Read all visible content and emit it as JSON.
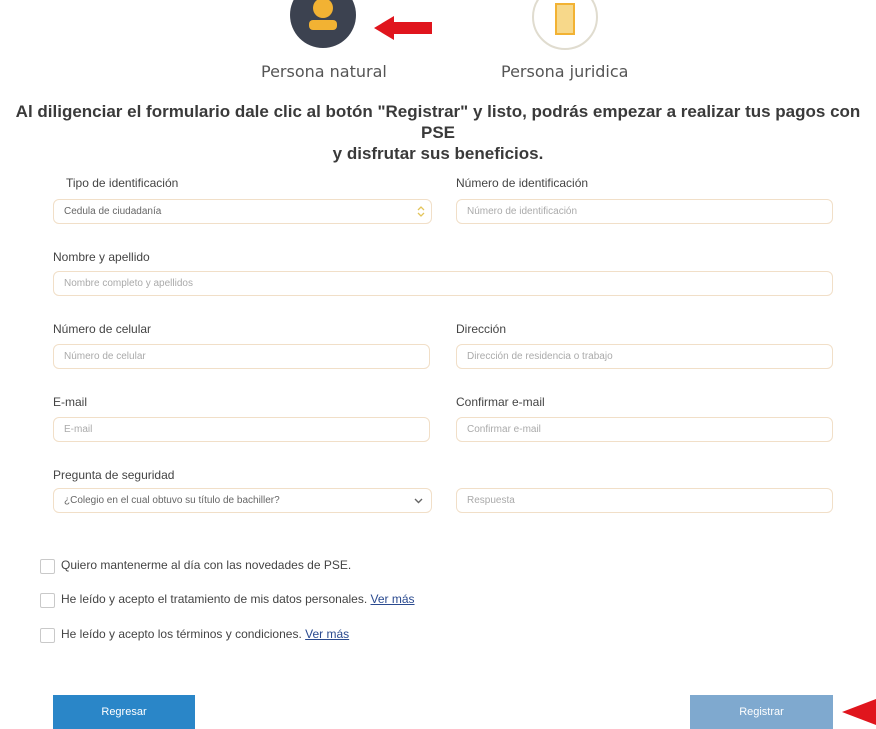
{
  "person_types": {
    "natural_label": "Persona natural",
    "juridica_label": "Persona juridica"
  },
  "intro": {
    "line1": "Al diligenciar el formulario dale clic al botón \"Registrar\" y listo, podrás empezar a realizar tus pagos con PSE",
    "line2": "y disfrutar sus beneficios."
  },
  "form": {
    "tipo_id": {
      "label": "Tipo de identificación",
      "value": "Cedula de ciudadanía"
    },
    "numero_id": {
      "label": "Número de identificación",
      "placeholder": "Número de identificación"
    },
    "nombre": {
      "label": "Nombre y apellido",
      "placeholder": "Nombre completo y apellidos"
    },
    "celular": {
      "label": "Número de celular",
      "placeholder": "Número de celular"
    },
    "direccion": {
      "label": "Dirección",
      "placeholder": "Dirección de residencia o trabajo"
    },
    "email": {
      "label": "E-mail",
      "placeholder": "E-mail"
    },
    "confirm_email": {
      "label": "Confirmar e-mail",
      "placeholder": "Confirmar e-mail"
    },
    "pregunta": {
      "label": "Pregunta de seguridad",
      "value": "¿Colegio en el cual obtuvo su título de bachiller?"
    },
    "respuesta": {
      "placeholder": "Respuesta"
    }
  },
  "checkboxes": [
    {
      "label": "Quiero mantenerme al día con las novedades de PSE.",
      "link": ""
    },
    {
      "label": "He leído y acepto el tratamiento de mis datos personales.",
      "link": "Ver más"
    },
    {
      "label": "He leído y acepto los términos y condiciones.",
      "link": "Ver más"
    }
  ],
  "buttons": {
    "back": "Regresar",
    "register": "Registrar"
  },
  "colors": {
    "natural_circle": "#3c4250",
    "person_icon": "#f2b233",
    "arrow": "#e0151d",
    "back_button": "#2a86c8",
    "register_button": "#7fa9cf",
    "field_border": "#f1dfc8"
  }
}
